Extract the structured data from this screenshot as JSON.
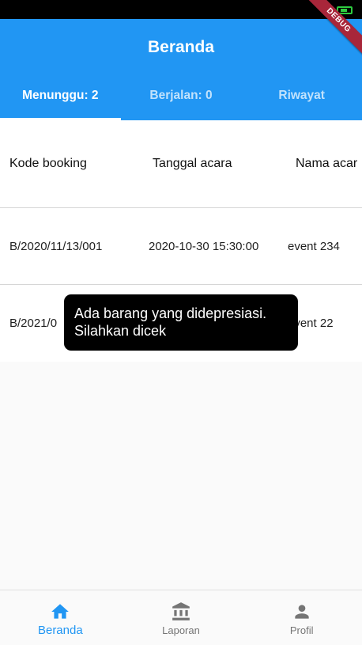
{
  "app_bar": {
    "title": "Beranda"
  },
  "tabs": [
    {
      "label": "Menunggu: 2",
      "active": true
    },
    {
      "label": "Berjalan: 0",
      "active": false
    },
    {
      "label": "Riwayat",
      "active": false
    }
  ],
  "table": {
    "headers": [
      "Kode booking",
      "Tanggal acara",
      "Nama acar"
    ],
    "rows": [
      [
        "B/2020/11/13/001",
        "2020-10-30 15:30:00",
        "event 234"
      ],
      [
        "B/2021/0",
        "",
        "event 22"
      ]
    ]
  },
  "toast": {
    "line1": "Ada barang yang didepresiasi.",
    "line2": "Silahkan dicek"
  },
  "bottom_nav": [
    {
      "label": "Beranda",
      "icon": "home-icon",
      "active": true
    },
    {
      "label": "Laporan",
      "icon": "bank-icon",
      "active": false
    },
    {
      "label": "Profil",
      "icon": "person-icon",
      "active": false
    }
  ],
  "debug_banner": "DEBUG",
  "colors": {
    "primary": "#2196f3",
    "inactive_nav": "#757575",
    "debug_ribbon": "#a8263a"
  }
}
